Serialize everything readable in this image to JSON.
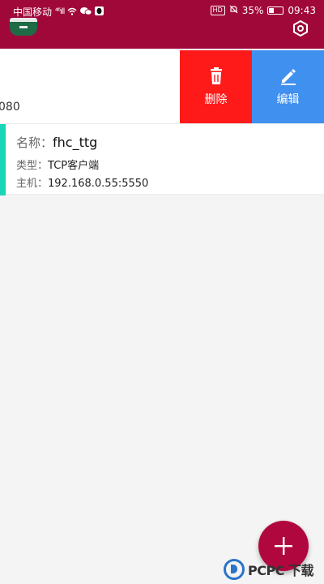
{
  "status_bar": {
    "carrier": "中国移动",
    "signal": "⁴⁶ıll",
    "hd_badge": "HD",
    "battery": "35%",
    "time": "09:43"
  },
  "colors": {
    "primary": "#a0083a",
    "delete": "#ff1a1a",
    "edit": "#4090f0",
    "accent": "#1ad6b8",
    "fab": "#b0083e"
  },
  "swipe_row": {
    "partial_text": "080",
    "delete_label": "删除",
    "edit_label": "编辑"
  },
  "connection": {
    "name_label": "名称：",
    "name_value": "fhc_ttg",
    "type_label": "类型：",
    "type_value": "TCP客户端",
    "host_label": "主机：",
    "host_value": "192.168.0.55:5550"
  },
  "icons": {
    "app": "app-logo-icon",
    "settings": "settings-hexagon-icon",
    "delete": "trash-icon",
    "edit": "pencil-icon",
    "fab": "plus-icon"
  },
  "watermark": {
    "text": "PCPC 下载"
  }
}
